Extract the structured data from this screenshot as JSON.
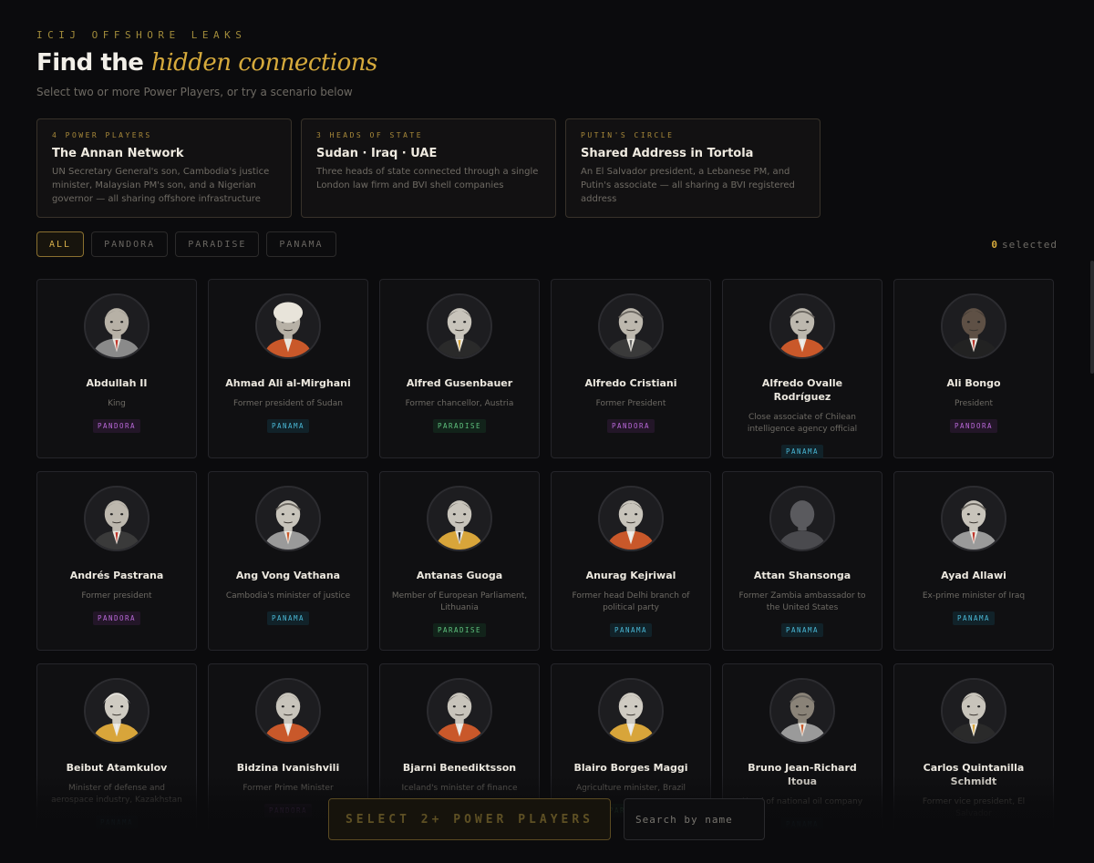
{
  "header": {
    "eyebrow": "ICIJ OFFSHORE LEAKS",
    "title_lead": "Find the ",
    "title_accent": "hidden connections",
    "subtitle": "Select two or more Power Players, or try a scenario below"
  },
  "scenarios": [
    {
      "tag": "4 POWER PLAYERS",
      "title": "The Annan Network",
      "desc": "UN Secretary General's son, Cambodia's justice minister, Malaysian PM's son, and a Nigerian governor — all sharing offshore infrastructure"
    },
    {
      "tag": "3 HEADS OF STATE",
      "title": "Sudan · Iraq · UAE",
      "desc": "Three heads of state connected through a single London law firm and BVI shell companies"
    },
    {
      "tag": "PUTIN'S CIRCLE",
      "title": "Shared Address in Tortola",
      "desc": "An El Salvador president, a Lebanese PM, and Putin's associate — all sharing a BVI registered address"
    }
  ],
  "filters": [
    "ALL",
    "PANDORA",
    "PARADISE",
    "PANAMA"
  ],
  "active_filter": "ALL",
  "selection": {
    "count": "0",
    "label": "selected"
  },
  "players": [
    {
      "name": "Abdullah II",
      "role": "King",
      "leak": "PANDORA",
      "style": {
        "hair": "gray",
        "jacket": "#8a8a8a",
        "tie": "#c0352b",
        "skin": "#b7b1a6"
      }
    },
    {
      "name": "Ahmad Ali al-Mirghani",
      "role": "Former president of Sudan",
      "leak": "PANAMA",
      "style": {
        "hair": "turban",
        "jacket": "#c9582a",
        "tie": "#e8e4da",
        "skin": "#b7b1a6"
      }
    },
    {
      "name": "Alfred Gusenbauer",
      "role": "Former chancellor, Austria",
      "leak": "PARADISE",
      "style": {
        "hair": "dark",
        "jacket": "#2a2a2a",
        "tie": "#d8a53a",
        "skin": "#c8c4bb"
      }
    },
    {
      "name": "Alfredo Cristiani",
      "role": "Former President",
      "leak": "PANDORA",
      "style": {
        "hair": "bald",
        "jacket": "#3a3a3a",
        "tie": "#6a6a6a",
        "skin": "#bdb8ae"
      }
    },
    {
      "name": "Alfredo Ovalle Rodríguez",
      "role": "Close associate of Chilean intelligence agency official",
      "leak": "PANAMA",
      "style": {
        "hair": "bald",
        "jacket": "#c9582a",
        "tie": "#eeeeee",
        "skin": "#bdb8ae"
      }
    },
    {
      "name": "Ali Bongo",
      "role": "President",
      "leak": "PANDORA",
      "style": {
        "hair": "dark",
        "jacket": "#222222",
        "tie": "#b8322a",
        "skin": "#5e5045"
      }
    },
    {
      "name": "Andrés Pastrana",
      "role": "Former president",
      "leak": "PANDORA",
      "style": {
        "hair": "gray",
        "jacket": "#3a3a3a",
        "tie": "#c0352b",
        "skin": "#bdb8ae"
      }
    },
    {
      "name": "Ang Vong Vathana",
      "role": "Cambodia's minister of justice",
      "leak": "PANAMA",
      "style": {
        "hair": "bald",
        "jacket": "#9a9a9a",
        "tie": "#c9582a",
        "skin": "#c8c4bb"
      }
    },
    {
      "name": "Antanas Guoga",
      "role": "Member of European Parliament, Lithuania",
      "leak": "PARADISE",
      "style": {
        "hair": "dark",
        "jacket": "#d8a53a",
        "tie": "#2a2a2a",
        "skin": "#c8c4bb"
      }
    },
    {
      "name": "Anurag Kejriwal",
      "role": "Former head Delhi branch of political party",
      "leak": "PANAMA",
      "style": {
        "hair": "dark",
        "jacket": "#c9582a",
        "tie": "#eeeeee",
        "skin": "#c8c4bb"
      }
    },
    {
      "name": "Attan Shansonga",
      "role": "Former Zambia ambassador to the United States",
      "leak": "PANAMA",
      "style": {
        "hair": "silhouette",
        "jacket": "#4a4a4e",
        "tie": "#4a4a4e",
        "skin": "#5a5a5e"
      }
    },
    {
      "name": "Ayad Allawi",
      "role": "Ex-prime minister of Iraq",
      "leak": "PANAMA",
      "style": {
        "hair": "bald",
        "jacket": "#9a9a9a",
        "tie": "#c0352b",
        "skin": "#c8c4bb"
      }
    },
    {
      "name": "Beibut Atamkulov",
      "role": "Minister of defense and aerospace industry, Kazakhstan",
      "leak": "PANAMA",
      "style": {
        "hair": "white",
        "jacket": "#d8a53a",
        "tie": "#eeeeee",
        "skin": "#cfcbc2"
      }
    },
    {
      "name": "Bidzina Ivanishvili",
      "role": "Former Prime Minister",
      "leak": "PANDORA",
      "style": {
        "hair": "gray",
        "jacket": "#c9582a",
        "tie": "#eeeeee",
        "skin": "#c8c4bb"
      }
    },
    {
      "name": "Bjarni Benediktsson",
      "role": "Iceland's minister of finance",
      "leak": "PANAMA",
      "style": {
        "hair": "dark",
        "jacket": "#c9582a",
        "tie": "#eeeeee",
        "skin": "#c8c4bb"
      }
    },
    {
      "name": "Blairo Borges Maggi",
      "role": "Agriculture minister, Brazil",
      "leak": "PARADISE",
      "style": {
        "hair": "gray",
        "jacket": "#d8a53a",
        "tie": "#eeeeee",
        "skin": "#cfcbc2"
      }
    },
    {
      "name": "Bruno Jean-Richard Itoua",
      "role": "Head of national oil company",
      "leak": "PANAMA",
      "style": {
        "hair": "bald",
        "jacket": "#9a9a9a",
        "tie": "#c9582a",
        "skin": "#8a8378"
      }
    },
    {
      "name": "Carlos Quintanilla Schmidt",
      "role": "Former vice president, El Salvador",
      "leak": "PANDORA",
      "style": {
        "hair": "dark",
        "jacket": "#2a2a2a",
        "tie": "#d8a53a",
        "skin": "#c8c4bb"
      }
    }
  ],
  "footer": {
    "cta_label": "SELECT 2+ POWER PLAYERS",
    "search_placeholder": "Search by name"
  }
}
